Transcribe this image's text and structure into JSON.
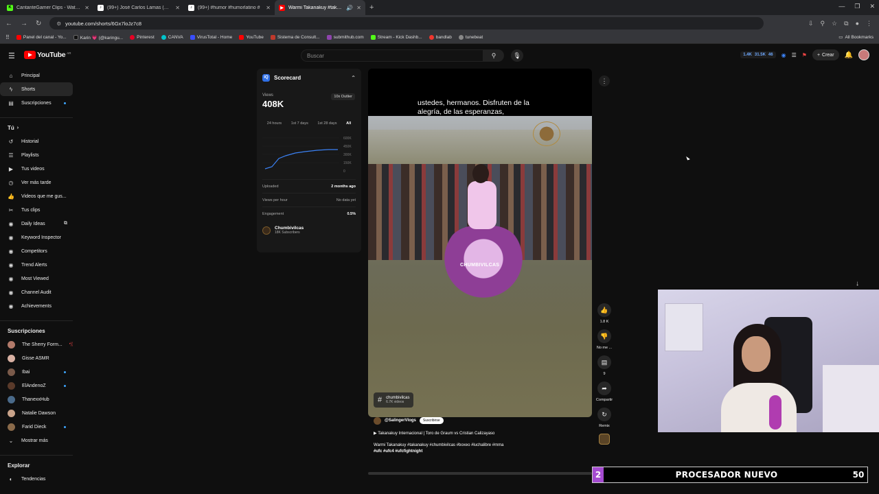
{
  "tabs": [
    {
      "label": "CantanteGamer Clips - Watch C",
      "fav": "K",
      "color": "#53fc18"
    },
    {
      "label": "(99+) José Carlos Lamas (@dina",
      "fav": "♪",
      "color": "#111111"
    },
    {
      "label": "(99+) #humor #humorlatino #",
      "fav": "♪",
      "color": "#111111"
    },
    {
      "label": "Warmi Takanakuy #takanaku",
      "fav": "▶",
      "color": "#ff0000",
      "active": true
    }
  ],
  "address": {
    "url": "youtube.com/shorts/6Gx7loJz7c8"
  },
  "bookmarks": [
    {
      "label": "Panel del canal - Yo...",
      "color": "#ff0000"
    },
    {
      "label": "Karin 💗 (@karingu...",
      "color": "#111111"
    },
    {
      "label": "Pinterest",
      "color": "#e60023"
    },
    {
      "label": "CANVA",
      "color": "#00c4cc"
    },
    {
      "label": "VirusTotal - Home",
      "color": "#394eff"
    },
    {
      "label": "YouTube",
      "color": "#ff0000"
    },
    {
      "label": "Sistema de Consult...",
      "color": "#c0392b"
    },
    {
      "label": "submithub.com",
      "color": "#8e44ad"
    },
    {
      "label": "Stream - Kick Dashb...",
      "color": "#53fc18"
    },
    {
      "label": "bandlab",
      "color": "#f0362d"
    },
    {
      "label": "tunebeat",
      "color": "#888888"
    }
  ],
  "all_bookmarks": "All Bookmarks",
  "header": {
    "logo": "YouTube",
    "country": "AR",
    "search_placeholder": "Buscar",
    "stats": [
      "1.4K",
      "31.5K",
      "46"
    ],
    "create": "Crear"
  },
  "sidebar": {
    "main": [
      {
        "label": "Principal",
        "icon": "⌂"
      },
      {
        "label": "Shorts",
        "icon": "ϟ",
        "active": true
      },
      {
        "label": "Suscripciones",
        "icon": "▤",
        "dot": true
      }
    ],
    "you_label": "Tú",
    "you": [
      {
        "label": "Historial",
        "icon": "↺"
      },
      {
        "label": "Playlists",
        "icon": "☰"
      },
      {
        "label": "Tus videos",
        "icon": "▶"
      },
      {
        "label": "Ver más tarde",
        "icon": "◷"
      },
      {
        "label": "Videos que me gus...",
        "icon": "👍"
      },
      {
        "label": "Tus clips",
        "icon": "✂"
      },
      {
        "label": "Daily Ideas",
        "icon": "◉"
      },
      {
        "label": "Keyword Inspector",
        "icon": "◉"
      },
      {
        "label": "Competitors",
        "icon": "◉"
      },
      {
        "label": "Trend Alerts",
        "icon": "◉"
      },
      {
        "label": "Most Viewed",
        "icon": "◉"
      },
      {
        "label": "Channel Audit",
        "icon": "◉"
      },
      {
        "label": "Achievements",
        "icon": "◉"
      }
    ],
    "subs_label": "Suscripciones",
    "subs": [
      {
        "label": "The Sherry Form...",
        "color": "#b27a6a"
      },
      {
        "label": "Gisse ASMR",
        "color": "#d9b1a3"
      },
      {
        "label": "Ibai",
        "color": "#7a5a4a",
        "dot": true
      },
      {
        "label": "ElAndenoZ",
        "color": "#5a3a2a",
        "dot": true
      },
      {
        "label": "ThanexxHub",
        "color": "#4a6a8a"
      },
      {
        "label": "Natalie Dawson",
        "color": "#c9a38a"
      },
      {
        "label": "Farid Dieck",
        "color": "#8a6a4a",
        "dot": true
      }
    ],
    "more": "Mostrar más",
    "explore_label": "Explorar",
    "explore": [
      {
        "label": "Tendencias",
        "icon": "◐"
      }
    ]
  },
  "scorecard": {
    "title": "Scorecard",
    "views_label": "Views",
    "views": "408K",
    "badge": "10x Outlier",
    "ranges": [
      "24 hours",
      "1st 7 days",
      "1st 28 days",
      "All"
    ],
    "y_ticks": [
      "600K",
      "450K",
      "300K",
      "150K",
      "0"
    ],
    "rows": [
      {
        "label": "Uploaded",
        "value": "2 months ago"
      },
      {
        "label": "Views per hour",
        "value": "No data yet"
      },
      {
        "label": "Engagement",
        "value": "0.5%"
      }
    ],
    "channel": {
      "name": "Chumbivilcas",
      "subs": "18K Subscribers"
    }
  },
  "video": {
    "caption_line1": "ustedes, hermanos. Disfruten de la",
    "caption_line2": "alegría, de las esperanzas,",
    "watermark": "CHUMBIVILCAS",
    "hashtag_name": "chumbivilcas",
    "hashtag_count": "6.7K videos"
  },
  "meta": {
    "channel": "@SalingerVlogs",
    "subscribe": "Suscribirse",
    "related": "Takanakuy Internacional | Toro de Graum vs Cristian Calizayaso",
    "description_line1": "Warmi Takanakuy #takanakuy #chumbivilcas #boxeo #luchalibre #mma",
    "description_line2": "#ufc #ufc4 #ufcfightnight"
  },
  "actions": [
    {
      "icon": "👍",
      "label": "1.8 K"
    },
    {
      "icon": "👎",
      "label": "No me ..."
    },
    {
      "icon": "▤",
      "label": "9"
    },
    {
      "icon": "➦",
      "label": "Compartir"
    },
    {
      "icon": "↻",
      "label": "Remix"
    }
  ],
  "overlay": {
    "left": "2",
    "label": "PROCESADOR NUEVO",
    "right": "50"
  }
}
